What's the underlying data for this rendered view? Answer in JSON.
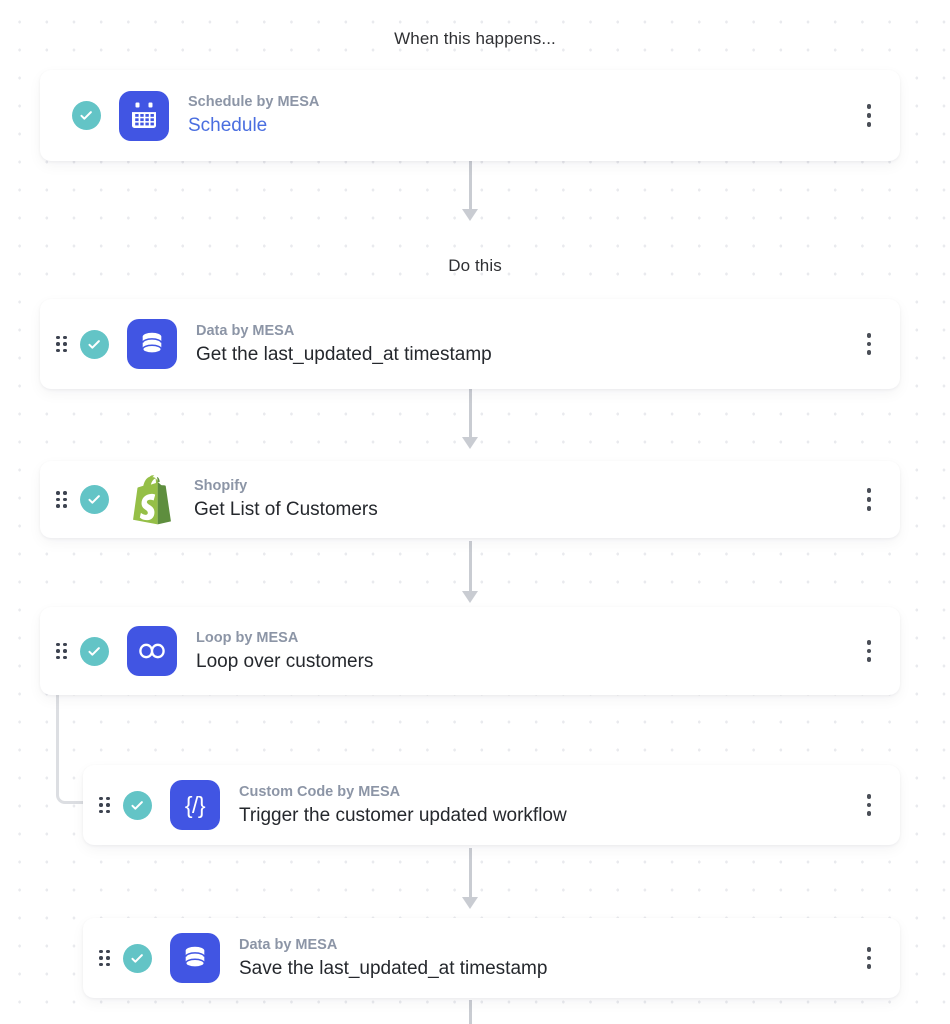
{
  "canvas": {
    "background_color": "#ffffff",
    "dot_color": "#e9eaee"
  },
  "theme": {
    "accent_blue": "#4155e3",
    "check_teal": "#63c4c6",
    "link_blue": "#4a6ee0",
    "subtitle_gray": "#8c95a6",
    "title_dark": "#25282d",
    "connector_gray": "#c9ccd2",
    "shopify_green": "#95bf47"
  },
  "labels": {
    "trigger_section": "When this happens...",
    "action_section": "Do this"
  },
  "steps": [
    {
      "id": "trigger-schedule",
      "app": "Schedule by MESA",
      "title": "Schedule",
      "title_is_link": true,
      "icon": "calendar-icon",
      "status": "complete",
      "has_drag_handle": false,
      "nested": false,
      "menu": "kebab-menu"
    },
    {
      "id": "action-get-timestamp",
      "app": "Data by MESA",
      "title": "Get the last_updated_at timestamp",
      "title_is_link": false,
      "icon": "database-icon",
      "status": "complete",
      "has_drag_handle": true,
      "nested": false,
      "menu": "kebab-menu"
    },
    {
      "id": "action-get-customers",
      "app": "Shopify",
      "title": "Get List of Customers",
      "title_is_link": false,
      "icon": "shopify-bag-icon",
      "status": "complete",
      "has_drag_handle": true,
      "nested": false,
      "menu": "kebab-menu"
    },
    {
      "id": "action-loop-customers",
      "app": "Loop by MESA",
      "title": "Loop over customers",
      "title_is_link": false,
      "icon": "infinity-icon",
      "status": "complete",
      "has_drag_handle": true,
      "nested": false,
      "menu": "kebab-menu"
    },
    {
      "id": "action-trigger-workflow",
      "app": "Custom Code by MESA",
      "title": "Trigger the customer updated workflow",
      "title_is_link": false,
      "icon": "custom-code-icon",
      "status": "complete",
      "has_drag_handle": true,
      "nested": true,
      "menu": "kebab-menu"
    },
    {
      "id": "action-save-timestamp",
      "app": "Data by MESA",
      "title": "Save the last_updated_at timestamp",
      "title_is_link": false,
      "icon": "database-icon",
      "status": "complete",
      "has_drag_handle": true,
      "nested": true,
      "menu": "kebab-menu"
    }
  ]
}
